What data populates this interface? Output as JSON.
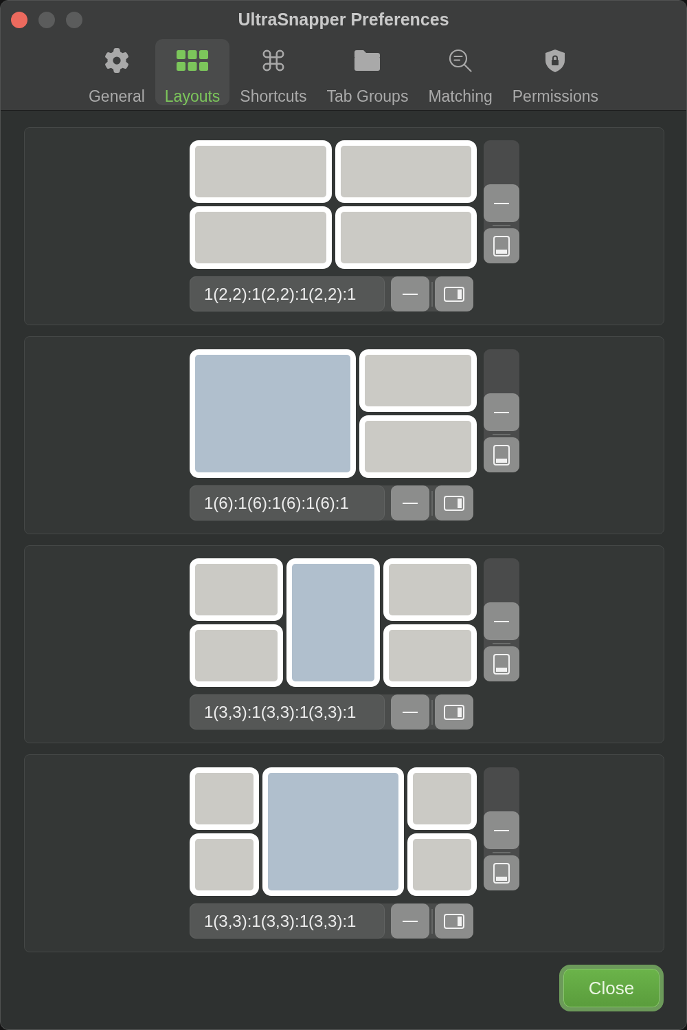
{
  "window": {
    "title": "UltraSnapper Preferences"
  },
  "window_buttons": [
    {
      "kind": "close",
      "disabled": false
    },
    {
      "kind": "minimize",
      "disabled": true
    },
    {
      "kind": "zoom",
      "disabled": true
    }
  ],
  "tabs": [
    {
      "label": "General",
      "selected": false
    },
    {
      "label": "Layouts",
      "selected": true
    },
    {
      "label": "Shortcuts",
      "selected": false
    },
    {
      "label": "Tab Groups",
      "selected": false
    },
    {
      "label": "Matching",
      "selected": false
    },
    {
      "label": "Permissions",
      "selected": false
    }
  ],
  "layouts": [
    {
      "kind": "two-by-two",
      "tiles": [
        {
          "selected": false
        },
        {
          "selected": false
        },
        {
          "selected": false
        },
        {
          "selected": false
        }
      ],
      "text_field": {
        "value": "1(2,2):1(2,2):1(2,2):1"
      }
    },
    {
      "kind": "large-left",
      "tiles": [
        {
          "selected": true
        },
        {
          "selected": false
        },
        {
          "selected": false
        }
      ],
      "text_field": {
        "value": "1(6):1(6):1(6):1(6):1"
      }
    },
    {
      "kind": "tall-center",
      "tiles": [
        {
          "selected": false
        },
        {
          "selected": true
        },
        {
          "selected": false
        },
        {
          "selected": false
        },
        {
          "selected": false
        }
      ],
      "text_field": {
        "value": "1(3,3):1(3,3):1(3,3):1"
      }
    },
    {
      "kind": "wide-center",
      "tiles": [
        {
          "selected": false
        },
        {
          "selected": true
        },
        {
          "selected": false
        },
        {
          "selected": false
        },
        {
          "selected": false
        }
      ],
      "text_field": {
        "value": "1(3,3):1(3,3):1(3,3):1"
      }
    }
  ],
  "close_button": {
    "label": "Close"
  }
}
